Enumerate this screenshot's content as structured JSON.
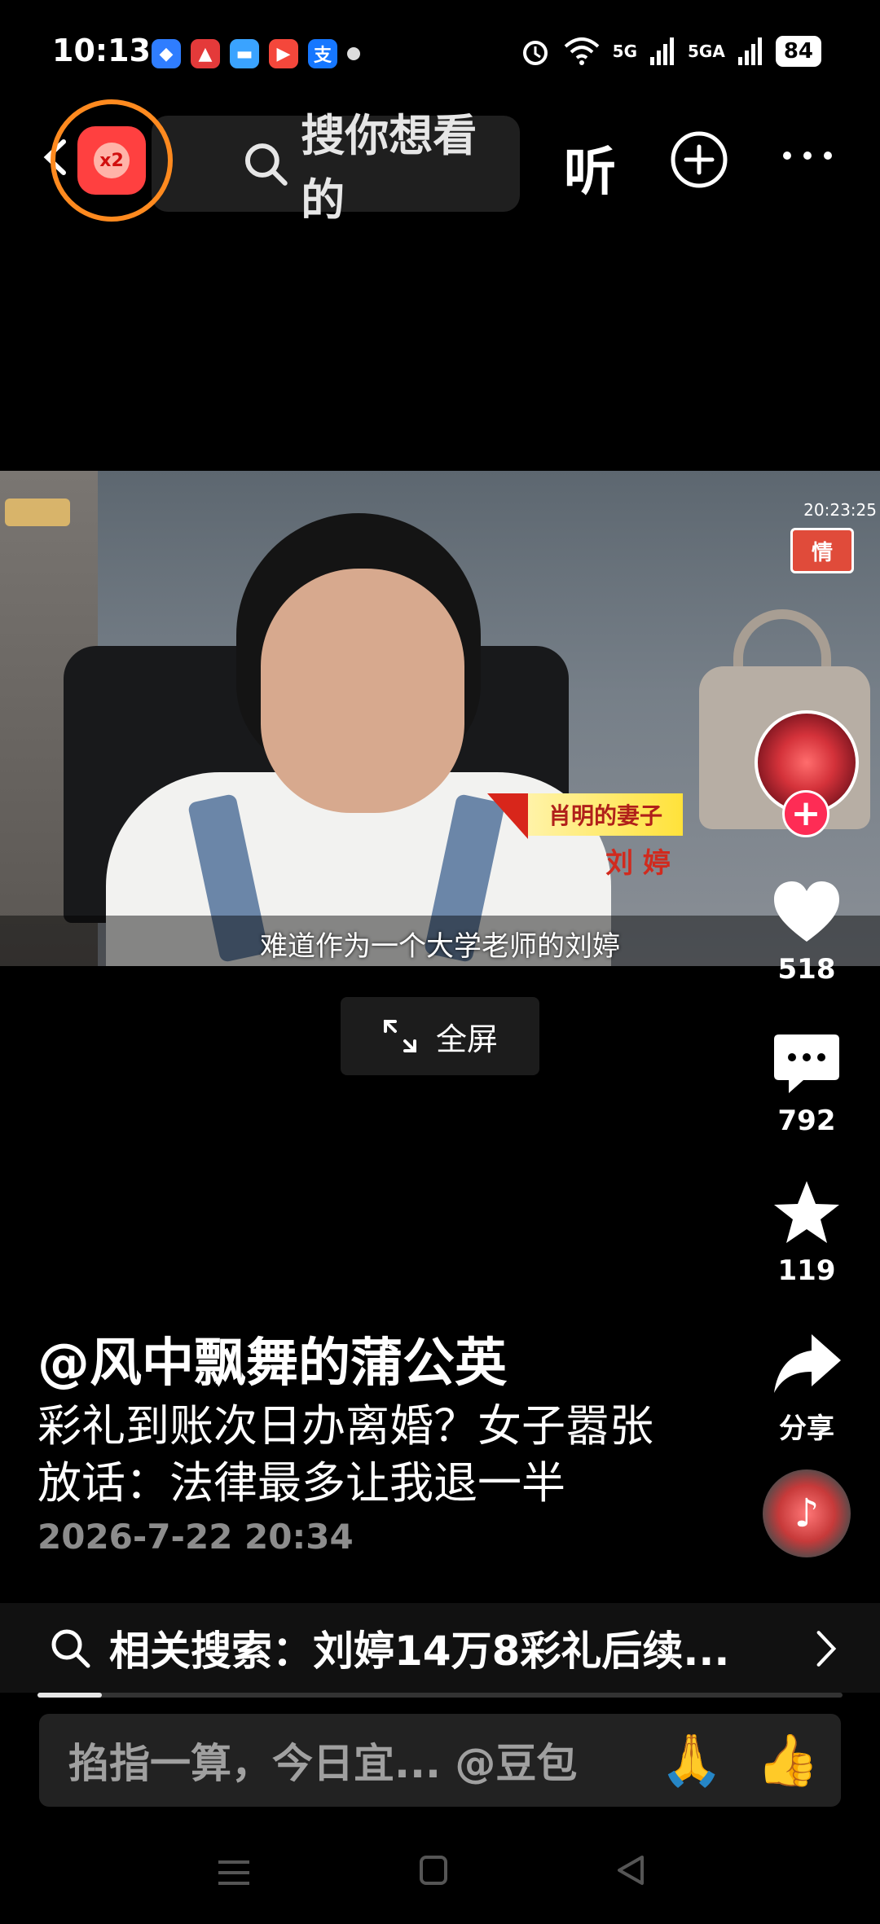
{
  "status_bar": {
    "time": "10:13",
    "signal_1": "5G",
    "signal_2": "5GA",
    "battery": "84"
  },
  "top_bar": {
    "redpack_badge": "x2",
    "search_placeholder": "搜你想看的",
    "listen_label": "听"
  },
  "video": {
    "tv_time": "20:23:25",
    "tv_badge": "情",
    "name_tag_title": "肖明的妻子",
    "name_tag_name": "刘 婷",
    "subtitle": "难道作为一个大学老师的刘婷",
    "fullscreen_label": "全屏"
  },
  "actions": {
    "follow": "+",
    "like_count": "518",
    "comment_count": "792",
    "favorite_count": "119",
    "share_label": "分享"
  },
  "info": {
    "author": "@风中飘舞的蒲公英",
    "description": "彩礼到账次日办离婚？女子嚣张放话：法律最多让我退一半",
    "date": "2026-7-22 20:34"
  },
  "related": {
    "text": "相关搜索：刘婷14万8彩礼后续..."
  },
  "comment": {
    "placeholder": "掐指一算，今日宜... @豆包",
    "emoji_1": "🙏",
    "emoji_2": "👍"
  },
  "progress": {
    "value": 0.08
  }
}
